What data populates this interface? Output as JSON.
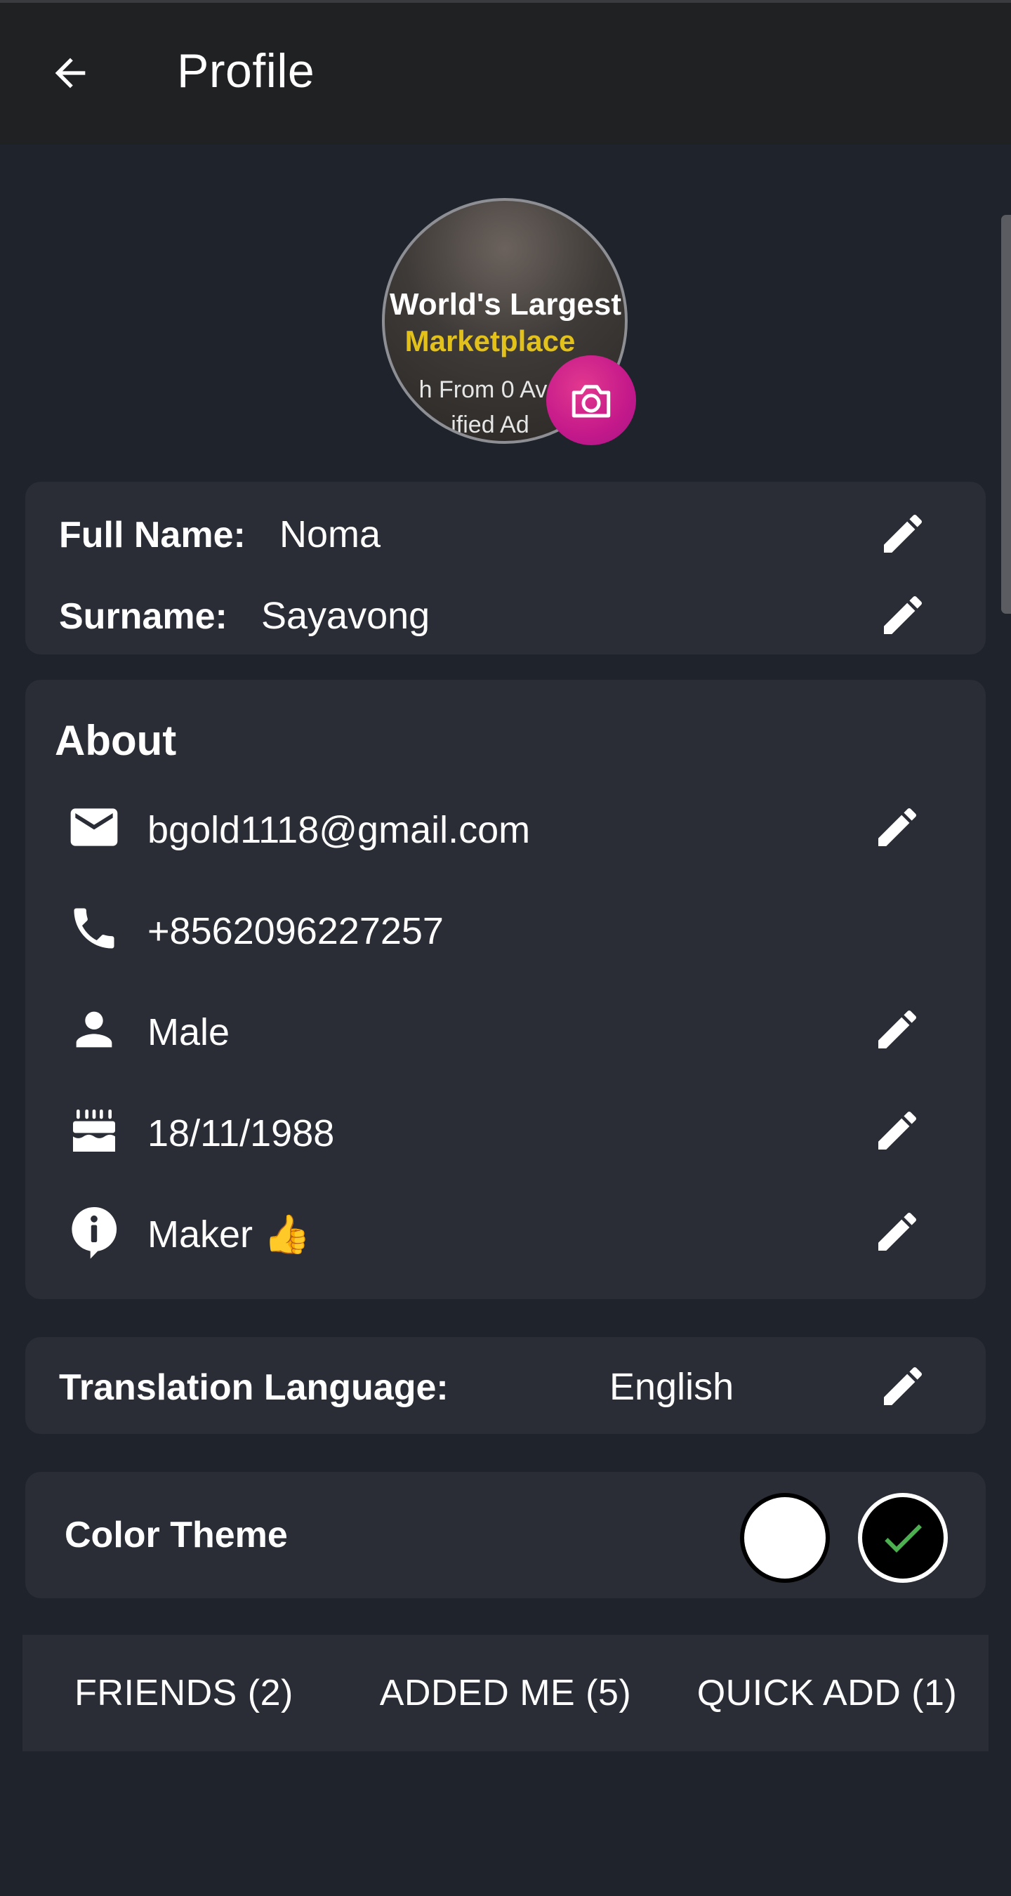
{
  "header": {
    "title": "Profile"
  },
  "avatar": {
    "line1": "World's Largest",
    "line2": "Marketplace",
    "line3": "h From 0 Av",
    "line4": "ified Ad"
  },
  "name_card": {
    "full_name_label": "Full Name:",
    "full_name_value": "Noma",
    "surname_label": "Surname:",
    "surname_value": "Sayavong"
  },
  "about": {
    "title": "About",
    "email": "bgold1118@gmail.com",
    "phone": "+8562096227257",
    "gender": "Male",
    "birthday": "18/11/1988",
    "bio": "Maker 👍"
  },
  "translation": {
    "label": "Translation Language:",
    "value": "English"
  },
  "theme": {
    "label": "Color Theme",
    "selected": "dark",
    "accent_check": "#4caf50"
  },
  "tabs": [
    {
      "label": "FRIENDS (2)"
    },
    {
      "label": "ADDED ME (5)"
    },
    {
      "label": "QUICK ADD (1)"
    }
  ],
  "colors": {
    "background": "#1f232b",
    "card": "#2a2d35",
    "appbar": "#202123",
    "camera_button": "#c4198a"
  }
}
